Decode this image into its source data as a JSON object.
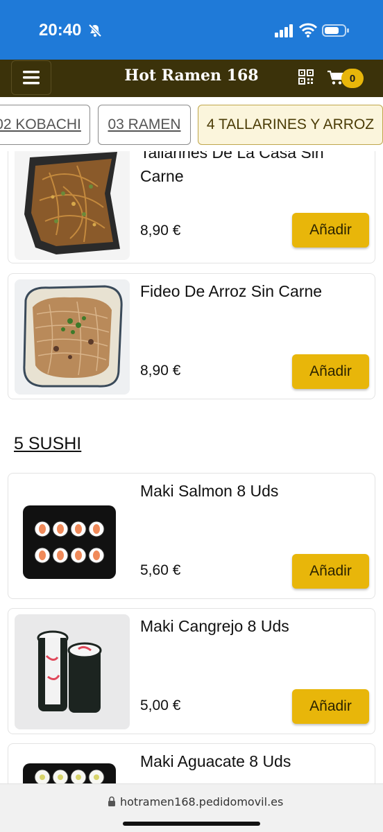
{
  "status_bar": {
    "time": "20:40"
  },
  "header": {
    "title": "Hot Ramen 168",
    "cart_count": "0"
  },
  "tabs": [
    {
      "label": "02 KOBACHI"
    },
    {
      "label": "03 RAMEN"
    },
    {
      "label": "4 TALLARINES Y ARROZ",
      "active": true
    }
  ],
  "products": [
    {
      "name": "Tallarines De La Casa Sin Carne",
      "price": "8,90 €",
      "add_label": "Añadir"
    },
    {
      "name": "Fideo De Arroz Sin Carne",
      "price": "8,90 €",
      "add_label": "Añadir"
    },
    {
      "name": "Maki Salmon 8 Uds",
      "price": "5,60 €",
      "add_label": "Añadir"
    },
    {
      "name": "Maki Cangrejo 8 Uds",
      "price": "5,00 €",
      "add_label": "Añadir"
    },
    {
      "name": "Maki Aguacate 8 Uds"
    }
  ],
  "sections": {
    "sushi": "5 SUSHI"
  },
  "browser": {
    "url": "hotramen168.pedidomovil.es"
  },
  "colors": {
    "status_bar": "#1f7ad8",
    "header": "#3b320a",
    "accent": "#e8b60a",
    "active_tab_bg": "#fbf5dc"
  }
}
